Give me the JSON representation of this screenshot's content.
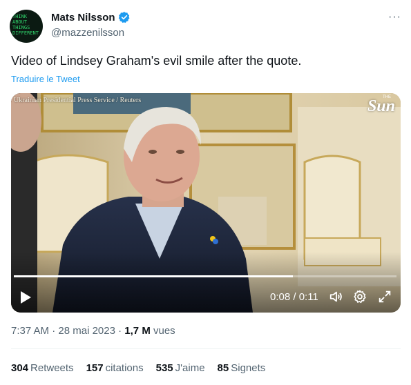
{
  "author": {
    "avatar_text": "THINK\nABOUT\nTHINGS\nDIFFERENT",
    "name": "Mats Nilsson",
    "handle": "@mazzenilsson",
    "verified_icon": "verified-badge-icon",
    "more_label": "···"
  },
  "tweet": {
    "text": "Video of Lindsey Graham's evil smile after the quote.",
    "translate_label": "Traduire le Tweet"
  },
  "video": {
    "credit": "Ukrainian Presidential Press Service / Reuters",
    "logo": "Sun",
    "logo_prefix": "THE",
    "time_label": "0:08 / 0:11",
    "progress_fraction": 0.73,
    "icons": [
      "play-icon",
      "volume-icon",
      "settings-icon",
      "fullscreen-icon"
    ]
  },
  "meta": {
    "time": "7:37 AM",
    "separator": "·",
    "date": "28 mai 2023",
    "views_count": "1,7 M",
    "views_label": "vues"
  },
  "stats": [
    {
      "count": "304",
      "label": "Retweets"
    },
    {
      "count": "157",
      "label": "citations"
    },
    {
      "count": "535",
      "label": "J'aime"
    },
    {
      "count": "85",
      "label": "Signets"
    }
  ],
  "colors": {
    "accent": "#1d9bf0",
    "text": "#0f1419",
    "muted": "#536471"
  }
}
